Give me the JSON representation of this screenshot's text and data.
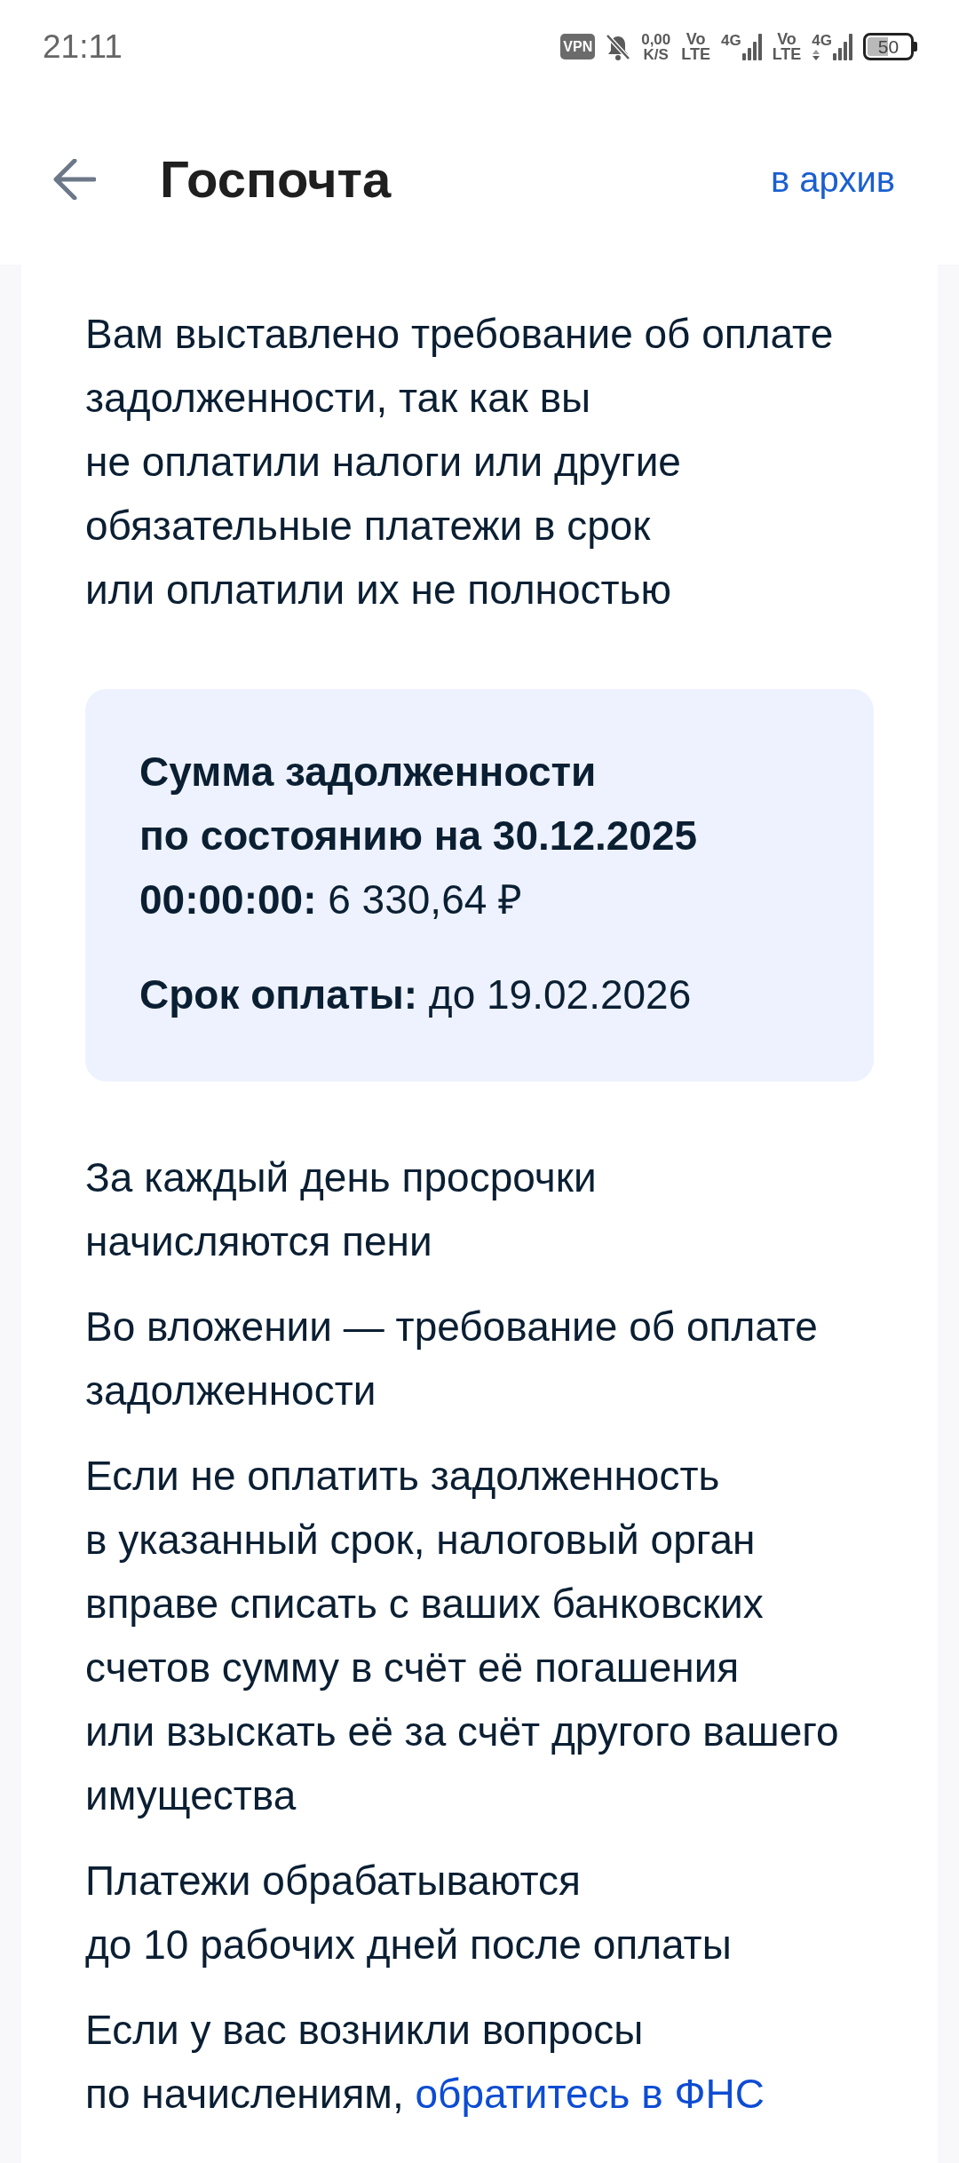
{
  "status_bar": {
    "time": "21:11",
    "vpn_badge": "VPN",
    "network_speed": "0,00\nK/S",
    "sims": [
      {
        "volte": "Vo\nLTE",
        "network": "4G",
        "data_activity": false
      },
      {
        "volte": "Vo\nLTE",
        "network": "4G",
        "data_activity": true
      }
    ],
    "battery": "50"
  },
  "header": {
    "title": "Госпочта",
    "archive_link": "в архив"
  },
  "message": {
    "blocks": [
      {
        "kind": "text",
        "text": "Вам выставлено требование об оплате\nзадолженности, так как вы\nне оплатили налоги или другие\nобязательные платежи в срок\nили оплатили их не полностью"
      },
      {
        "kind": "summary",
        "rows": [
          {
            "label": "Сумма задолженности\nпо состоянию на 30.12.2025\n00:00:00:",
            "value": "6 330,64 ₽"
          },
          {
            "label": "Срок оплаты:",
            "value": "до 19.02.2026"
          }
        ]
      },
      {
        "kind": "text",
        "text": "За каждый день просрочки\nначисляются пени"
      },
      {
        "kind": "text",
        "text": "Во вложении — требование об оплате\nзадолженности"
      },
      {
        "kind": "text",
        "text": "Если не оплатить задолженность\nв указанный срок, налоговый орган\nвправе списать с ваших банковских\nсчетов сумму в счёт её погашения\nили взыскать её за счёт другого вашего\nимущества"
      },
      {
        "kind": "text",
        "text": "Платежи обрабатываются\nдо 10 рабочих дней после оплаты"
      },
      {
        "kind": "text",
        "text": "Если у вас возникли вопросы\nпо начислениям,",
        "link": "обратитесь в ФНС"
      }
    ]
  }
}
